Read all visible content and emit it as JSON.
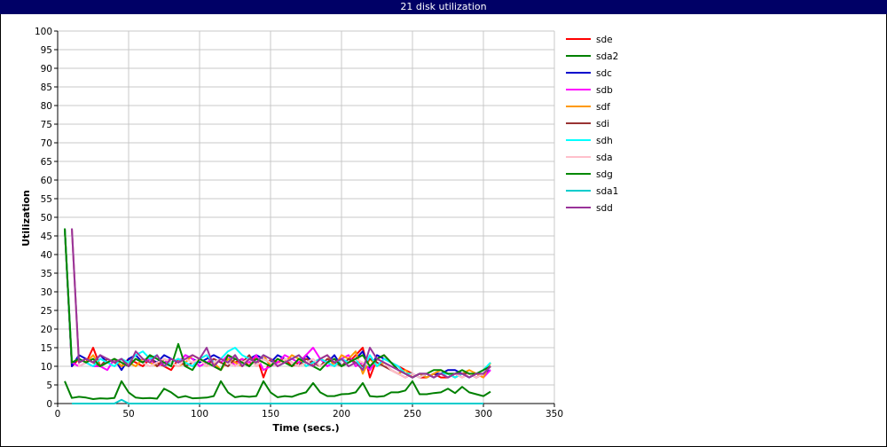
{
  "title": "21 disk utilization",
  "chart_data": {
    "type": "line",
    "xlabel": "Time (secs.)",
    "ylabel": "Utilization",
    "xlim": [
      0,
      350
    ],
    "ylim": [
      0,
      100
    ],
    "xticks": [
      0,
      50,
      100,
      150,
      200,
      250,
      300,
      350
    ],
    "yticks": [
      0,
      5,
      10,
      15,
      20,
      25,
      30,
      35,
      40,
      45,
      50,
      55,
      60,
      65,
      70,
      75,
      80,
      85,
      90,
      95,
      100
    ],
    "grid": true,
    "legend_position": "right",
    "x": [
      5,
      10,
      15,
      20,
      25,
      30,
      35,
      40,
      45,
      50,
      55,
      60,
      65,
      70,
      75,
      80,
      85,
      90,
      95,
      100,
      105,
      110,
      115,
      120,
      125,
      130,
      135,
      140,
      145,
      150,
      155,
      160,
      165,
      170,
      175,
      180,
      185,
      190,
      195,
      200,
      205,
      210,
      215,
      220,
      225,
      230,
      235,
      240,
      245,
      250,
      255,
      260,
      265,
      270,
      275,
      280,
      285,
      290,
      295,
      300,
      305
    ],
    "series": [
      {
        "name": "sde",
        "color": "#ff0000",
        "values": [
          47,
          10,
          12,
          11,
          15,
          10,
          12,
          11,
          10,
          12,
          11,
          10,
          12,
          11,
          10,
          9,
          12,
          11,
          10,
          12,
          13,
          10,
          9,
          12,
          11,
          12,
          10,
          13,
          7,
          12,
          11,
          12,
          10,
          11,
          13,
          10,
          12,
          11,
          10,
          12,
          11,
          13,
          15,
          7,
          12,
          13,
          11,
          10,
          9,
          8,
          7,
          7,
          8,
          7,
          7,
          8,
          7,
          8,
          7,
          8,
          10
        ]
      },
      {
        "name": "sda2",
        "color": "#008000",
        "values": [
          6,
          1.5,
          1.8,
          1.6,
          1.2,
          1.4,
          1.3,
          1.5,
          6,
          3,
          1.6,
          1.4,
          1.5,
          1.3,
          4,
          3,
          1.6,
          2,
          1.4,
          1.5,
          1.6,
          2,
          6,
          3,
          1.7,
          2,
          1.8,
          2,
          6,
          3,
          1.7,
          2,
          1.8,
          2.5,
          3,
          5.5,
          3,
          2,
          2,
          2.5,
          2.6,
          3,
          5.5,
          2,
          1.8,
          2,
          3,
          3,
          3.5,
          6,
          2.5,
          2.5,
          2.8,
          3,
          4,
          2.8,
          4.5,
          3,
          2.5,
          2,
          3.2
        ]
      },
      {
        "name": "sdc",
        "color": "#0000cc",
        "values": [
          47,
          10,
          13,
          12,
          11,
          13,
          11,
          12,
          9,
          12,
          13,
          11,
          12,
          11,
          13,
          12,
          11,
          13,
          12,
          11,
          12,
          13,
          12,
          11,
          13,
          10,
          12,
          13,
          12,
          11,
          13,
          12,
          11,
          10,
          13,
          11,
          12,
          11,
          13,
          10,
          11,
          12,
          14,
          9,
          13,
          12,
          11,
          9,
          8,
          7,
          8,
          7,
          8,
          8,
          9,
          9,
          8,
          8,
          7,
          8,
          9
        ]
      },
      {
        "name": "sdb",
        "color": "#ff00ff",
        "values": [
          47,
          11,
          10,
          11,
          10,
          10,
          9,
          12,
          11,
          10,
          12,
          11,
          12,
          10,
          11,
          12,
          11,
          13,
          12,
          10,
          11,
          12,
          11,
          13,
          10,
          12,
          11,
          13,
          9,
          10,
          11,
          13,
          12,
          11,
          13,
          15,
          12,
          10,
          11,
          12,
          13,
          10,
          11,
          9,
          12,
          11,
          9,
          8,
          7,
          8,
          7,
          8,
          7,
          8,
          7,
          8,
          8,
          7,
          8,
          7,
          9
        ]
      },
      {
        "name": "sdf",
        "color": "#ff9900",
        "values": [
          47,
          11,
          12,
          11,
          13,
          10,
          11,
          12,
          10,
          11,
          10,
          12,
          11,
          10,
          12,
          11,
          10,
          11,
          13,
          12,
          10,
          11,
          9,
          12,
          11,
          10,
          12,
          11,
          13,
          10,
          12,
          11,
          13,
          12,
          10,
          11,
          12,
          13,
          10,
          13,
          12,
          14,
          8,
          12,
          10,
          11,
          9,
          8,
          9,
          7,
          8,
          7,
          8,
          9,
          8,
          7,
          8,
          9,
          8,
          7,
          11
        ]
      },
      {
        "name": "sdi",
        "color": "#993333",
        "values": [
          null,
          47,
          11,
          12,
          11,
          10,
          12,
          11,
          12,
          10,
          12,
          11,
          13,
          10,
          12,
          11,
          12,
          10,
          11,
          12,
          10,
          12,
          11,
          10,
          12,
          11,
          13,
          10,
          12,
          11,
          10,
          12,
          11,
          10,
          12,
          11,
          10,
          12,
          11,
          10,
          12,
          11,
          10,
          12,
          11,
          10,
          9,
          8,
          7,
          8,
          7,
          8,
          7,
          8,
          8,
          7,
          8,
          8,
          7,
          8,
          10
        ]
      },
      {
        "name": "sdh",
        "color": "#00ffff",
        "values": [
          47,
          11,
          12,
          11,
          10,
          12,
          11,
          10,
          12,
          11,
          13,
          14,
          12,
          13,
          10,
          11,
          12,
          11,
          10,
          12,
          13,
          11,
          12,
          14,
          15,
          13,
          12,
          11,
          13,
          12,
          10,
          11,
          12,
          13,
          10,
          11,
          12,
          11,
          10,
          12,
          11,
          12,
          9,
          13,
          10,
          12,
          11,
          10,
          8,
          8,
          7,
          8,
          7,
          8,
          8,
          7,
          8,
          7,
          8,
          9,
          11
        ]
      },
      {
        "name": "sda",
        "color": "#ffc0cb",
        "values": [
          null,
          47,
          10,
          11,
          12,
          10,
          11,
          12,
          11,
          10,
          12,
          11,
          10,
          11,
          12,
          11,
          10,
          12,
          11,
          12,
          10,
          11,
          12,
          11,
          10,
          11,
          12,
          10,
          12,
          11,
          10,
          12,
          11,
          10,
          11,
          12,
          10,
          11,
          12,
          10,
          11,
          12,
          11,
          10,
          12,
          11,
          9,
          8,
          7,
          8,
          7,
          8,
          7,
          8,
          7,
          8,
          7,
          8,
          7,
          8,
          10
        ]
      },
      {
        "name": "sdg",
        "color": "#008800",
        "values": [
          47,
          11,
          12,
          11,
          12,
          10,
          11,
          12,
          11,
          10,
          12,
          11,
          13,
          12,
          11,
          10,
          16,
          10,
          9,
          12,
          11,
          10,
          9,
          13,
          12,
          11,
          10,
          12,
          11,
          10,
          12,
          11,
          10,
          12,
          11,
          10,
          9,
          11,
          12,
          10,
          11,
          12,
          13,
          10,
          12,
          13,
          11,
          9,
          8,
          7,
          8,
          8,
          9,
          9,
          8,
          8,
          9,
          8,
          8,
          9,
          10
        ]
      },
      {
        "name": "sda1",
        "color": "#00cccc",
        "values": [
          null,
          0,
          0,
          0,
          0,
          0,
          0,
          0,
          1,
          0,
          0,
          0,
          0,
          0,
          0,
          0,
          0,
          0,
          0,
          0,
          0,
          0,
          0,
          0,
          0,
          0,
          0,
          0,
          0,
          0,
          0,
          0,
          0,
          0,
          0,
          0,
          0,
          0,
          0,
          0,
          0,
          0,
          0,
          0,
          0,
          0,
          0,
          0,
          0,
          0,
          0,
          0,
          0,
          0,
          0,
          0,
          0,
          0,
          0,
          0,
          null
        ]
      },
      {
        "name": "sdd",
        "color": "#993399",
        "values": [
          null,
          47,
          11,
          12,
          11,
          13,
          12,
          11,
          12,
          10,
          14,
          12,
          11,
          13,
          10,
          12,
          11,
          12,
          13,
          12,
          15,
          10,
          12,
          11,
          13,
          10,
          12,
          11,
          13,
          12,
          10,
          11,
          12,
          13,
          11,
          10,
          12,
          13,
          11,
          12,
          10,
          11,
          9,
          15,
          12,
          11,
          10,
          9,
          8,
          7,
          8,
          8,
          7,
          8,
          7,
          8,
          8,
          7,
          8,
          8,
          10
        ]
      }
    ]
  }
}
